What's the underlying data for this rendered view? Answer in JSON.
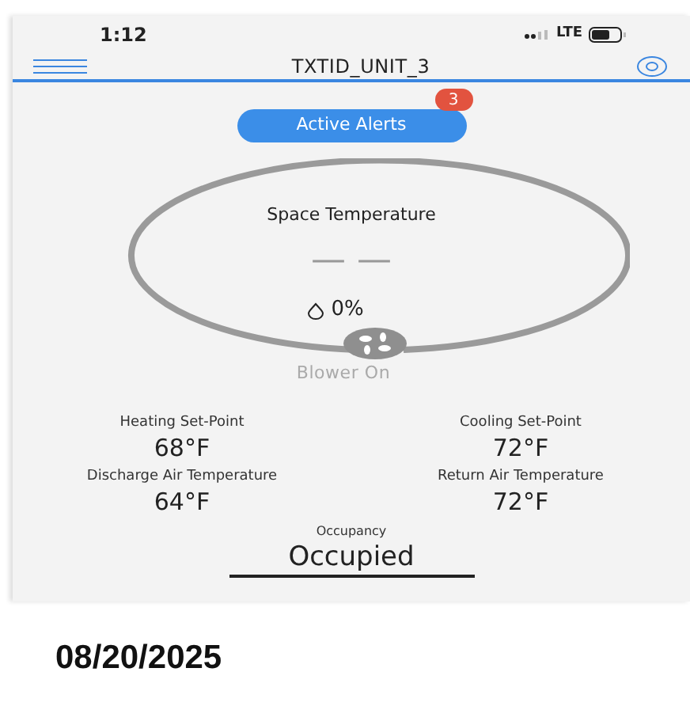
{
  "status_bar": {
    "time": "1:12",
    "network": "LTE"
  },
  "header": {
    "title": "TXTID_UNIT_3"
  },
  "alerts": {
    "label": "Active Alerts",
    "count": "3"
  },
  "gauge": {
    "title": "Space Temperature",
    "value": "— —",
    "humidity": "0%",
    "blower": "Blower On"
  },
  "readings": [
    {
      "label": "Heating Set-Point",
      "value": "68°F"
    },
    {
      "label": "Cooling Set-Point",
      "value": "72°F"
    },
    {
      "label": "Discharge Air Temperature",
      "value": "64°F"
    },
    {
      "label": "Return Air Temperature",
      "value": "72°F"
    }
  ],
  "occupancy": {
    "label": "Occupancy",
    "value": "Occupied"
  },
  "date": "08/20/2025"
}
